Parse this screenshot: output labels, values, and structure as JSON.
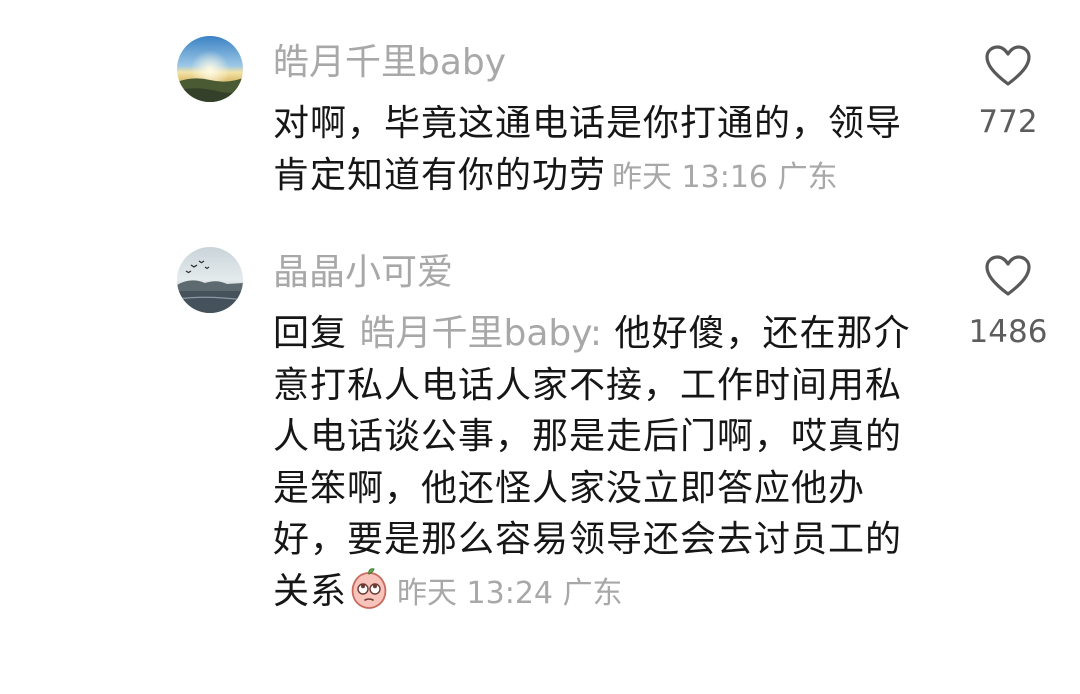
{
  "comments": [
    {
      "username": "皓月千里baby",
      "text": "对啊，毕竟这通电话是你打通的，领导肯定知道有你的功劳",
      "timestamp": "昨天 13:16",
      "location": "广东",
      "likes": "772",
      "avatar_icon": "sunrise-landscape-avatar"
    },
    {
      "username": "晶晶小可爱",
      "reply_prefix": "回复",
      "reply_target": "皓月千里baby:",
      "text": "他好傻，还在那介意打私人电话人家不接，工作时间用私人电话谈公事，那是走后门啊，哎真的是笨啊，他还怪人家没立即答应他办好，要是那么容易领导还会去讨员工的关系",
      "timestamp": "昨天 13:24",
      "location": "广东",
      "likes": "1486",
      "avatar_icon": "lake-birds-avatar",
      "emoji": "peach-rolling-eyes-emoji"
    }
  ],
  "colors": {
    "text": "#161616",
    "secondary": "#a8a8a8",
    "like_count": "#5d5d5d"
  },
  "icons": {
    "like": "heart-outline-icon"
  }
}
